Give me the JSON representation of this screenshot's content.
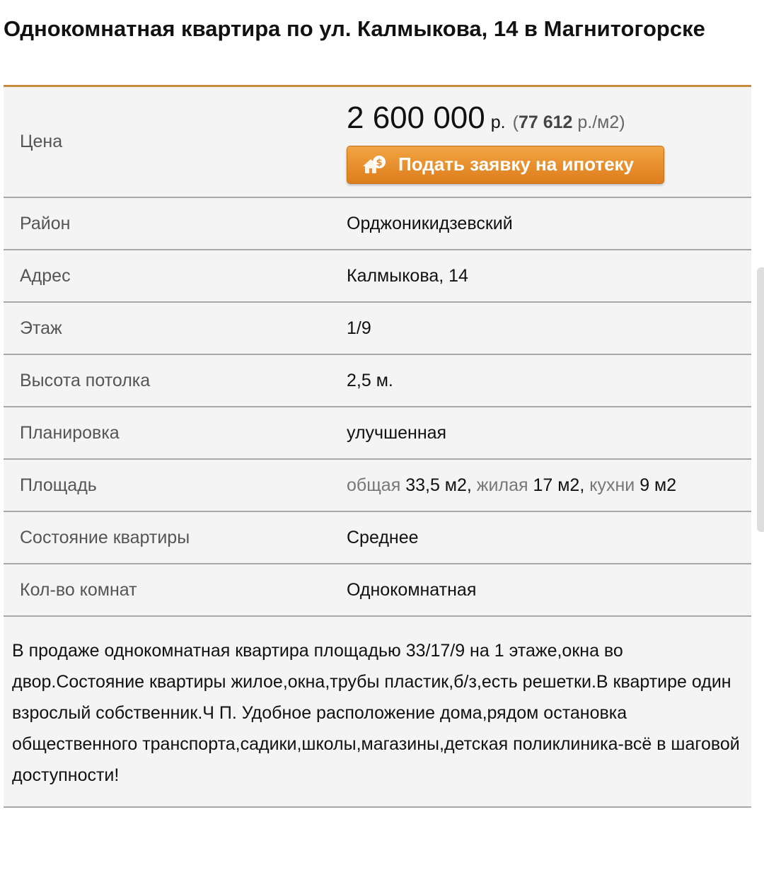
{
  "listing": {
    "title": "Однокомнатная квартира по ул. Калмыкова, 14 в Магнитогорске",
    "price": {
      "label": "Цена",
      "amount": "2 600 000",
      "currency": "р.",
      "per_sqm_open": "(",
      "per_sqm_value": "77 612",
      "per_sqm_unit": " р./м2)",
      "mortgage_button": "Подать заявку на ипотеку"
    },
    "rows": [
      {
        "label": "Район",
        "value": "Орджоникидзевский"
      },
      {
        "label": "Адрес",
        "value": "Калмыкова, 14"
      },
      {
        "label": "Этаж",
        "value": "1/9"
      },
      {
        "label": "Высота потолка",
        "value": "2,5 м."
      },
      {
        "label": "Планировка",
        "value": "улучшенная"
      }
    ],
    "area": {
      "label": "Площадь",
      "total_label": "общая",
      "total_value": "33,5 м2",
      "living_label": "жилая",
      "living_value": "17 м2",
      "kitchen_label": "кухни",
      "kitchen_value": "9 м2"
    },
    "rows2": [
      {
        "label": "Состояние квартиры",
        "value": "Среднее"
      },
      {
        "label": "Кол-во комнат",
        "value": "Однокомнатная"
      }
    ],
    "description": "В продаже однокомнатная квартира площадью 33/17/9 на 1 этаже,окна во двор.Состояние квартиры жилое,окна,трубы пластик,б/з,есть решетки.В квартире один взрослый собственник.Ч П. Удобное расположение дома,рядом остановка общественного транспорта,садики,школы,магазины,детская поликлиника-всё в шаговой доступности!"
  },
  "colors": {
    "accent": "#c98a3c",
    "button": "#e88d2d",
    "row_bg": "#f4f4f4",
    "divider": "#a8a8a8"
  },
  "icons": {
    "mortgage": "house-coin-icon"
  }
}
